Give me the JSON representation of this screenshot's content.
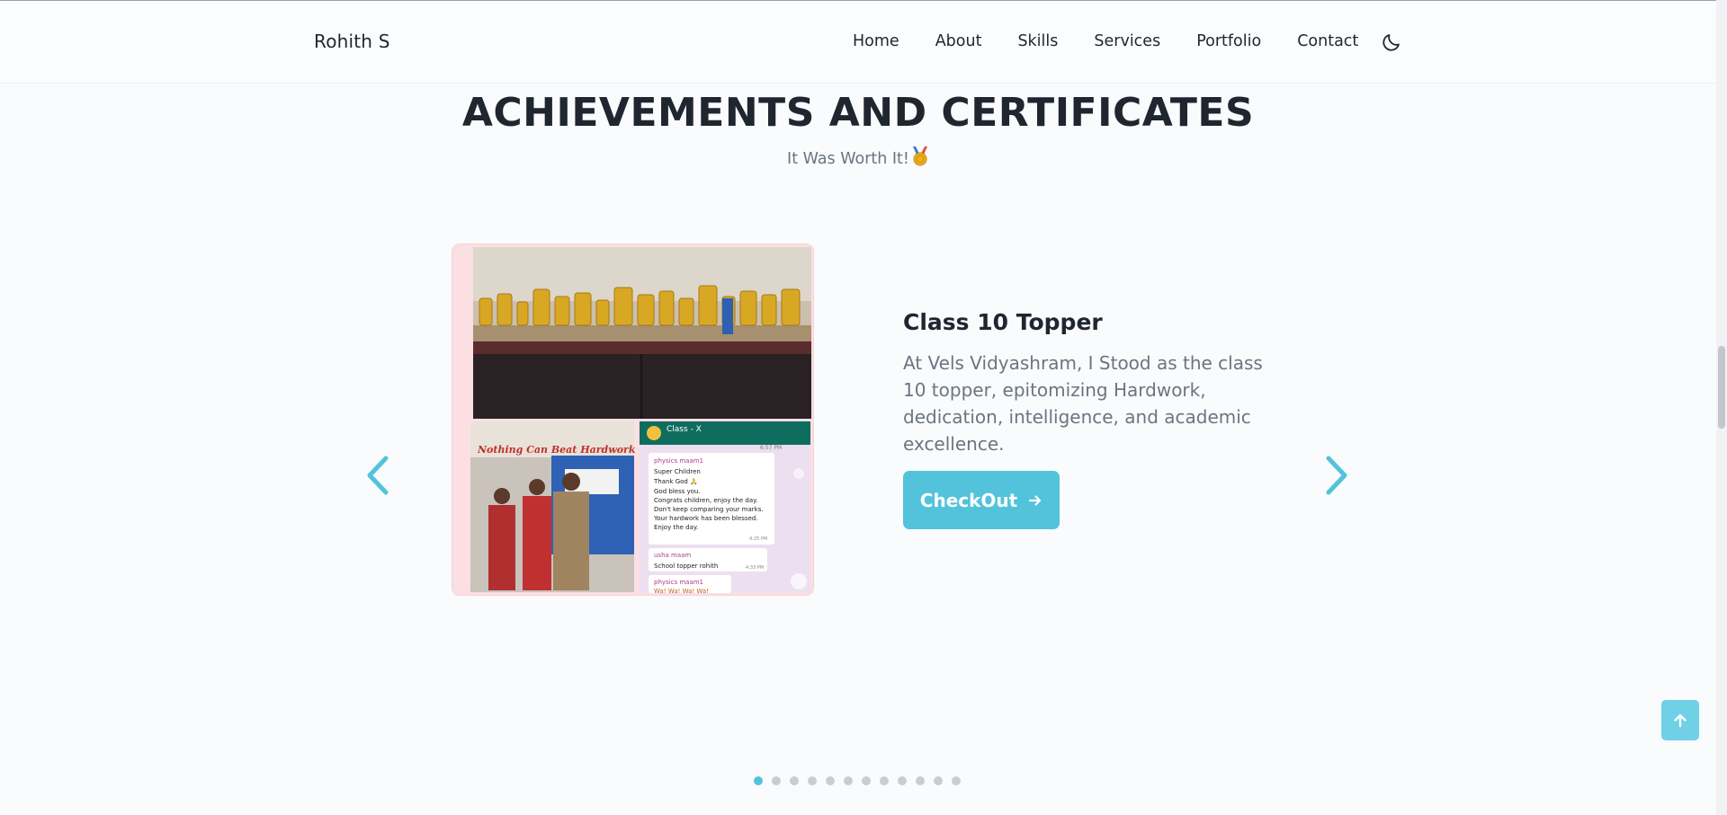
{
  "nav": {
    "brand": "Rohith S",
    "links": [
      "Home",
      "About",
      "Skills",
      "Services",
      "Portfolio",
      "Contact"
    ]
  },
  "section": {
    "title": "ACHIEVEMENTS AND CERTIFICATES",
    "subtitle": "It Was Worth It!"
  },
  "slide": {
    "title": "Class 10 Topper",
    "description": "At Vels Vidyashram, I Stood as the class 10 topper, epitomizing Hardwork, dedication, intelligence, and academic excellence.",
    "cta_label": "CheckOut",
    "image": {
      "banner_text": "Nothing Can Beat Hardwork",
      "chat": {
        "group_name": "Class - X",
        "header_time": "6:57 PM",
        "sender1": "physics maam1",
        "lines": [
          "Super Children",
          "Thank God 🙏",
          "God bless you.",
          "Congrats children, enjoy the day.",
          "Don't keep comparing your marks.",
          "Your hardwork has been blessed.",
          "Enjoy the day."
        ],
        "time1": "4:25 PM",
        "sender2": "usha maam",
        "msg2": "School topper rohith",
        "time2": "4:33 PM",
        "sender3": "physics maam1",
        "msg3": "Wa! Wa! Wa! Wa!"
      }
    }
  },
  "carousel": {
    "active_index": 0,
    "total_slides": 12
  },
  "colors": {
    "accent": "#53c3dc",
    "background": "#f9fbfd",
    "text_dark": "#1f2630",
    "text_muted": "#6b7580"
  }
}
